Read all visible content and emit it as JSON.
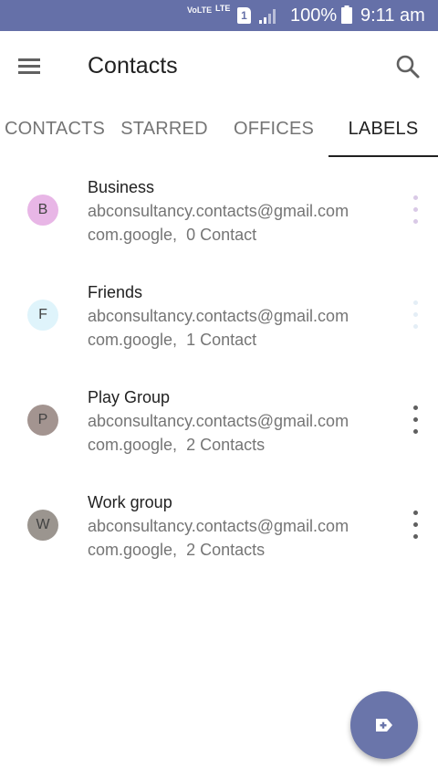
{
  "status_bar": {
    "volte": "VoLTE",
    "lte": "LTE",
    "sim_slot": "1",
    "battery": "100%",
    "time": "9:11 am"
  },
  "app_bar": {
    "title": "Contacts",
    "menu_icon": "menu-icon",
    "search_icon": "search-icon"
  },
  "tabs": [
    {
      "label": "CONTACTS",
      "active": false
    },
    {
      "label": "STARRED",
      "active": false
    },
    {
      "label": "OFFICES",
      "active": false
    },
    {
      "label": "LABELS",
      "active": true
    }
  ],
  "labels": [
    {
      "initial": "B",
      "name": "Business",
      "account": "abconsultancy.contacts@gmail.com",
      "source": "com.google,",
      "count": "0 Contact",
      "avatar_color": "#e8b6e6"
    },
    {
      "initial": "F",
      "name": "Friends",
      "account": "abconsultancy.contacts@gmail.com",
      "source": "com.google,",
      "count": "1 Contact",
      "avatar_color": "#dff4fb"
    },
    {
      "initial": "P",
      "name": "Play Group",
      "account": "abconsultancy.contacts@gmail.com",
      "source": "com.google,",
      "count": "2 Contacts",
      "avatar_color": "#a39490"
    },
    {
      "initial": "W",
      "name": "Work group",
      "account": "abconsultancy.contacts@gmail.com",
      "source": "com.google,",
      "count": "2 Contacts",
      "avatar_color": "#9b958f"
    }
  ],
  "fab": {
    "icon": "add-label-icon"
  },
  "colors": {
    "status_bar": "#6570a8",
    "fab": "#6a75aa",
    "text_primary": "#212121",
    "text_secondary": "#757575"
  }
}
